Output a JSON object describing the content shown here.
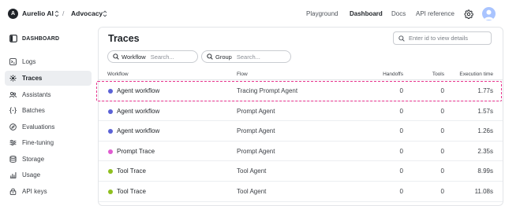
{
  "topbar": {
    "org_initial": "A",
    "org_name": "Aurelio AI",
    "separator": "/",
    "project_name": "Advocacy",
    "nav": [
      {
        "label": "Playground",
        "active": false
      },
      {
        "label": "Dashboard",
        "active": true
      },
      {
        "label": "Docs",
        "active": false
      },
      {
        "label": "API reference",
        "active": false
      }
    ],
    "settings_icon": "gear-icon",
    "avatar_icon": "user-avatar-icon"
  },
  "sidebar": {
    "title": "DASHBOARD",
    "title_icon": "sidebar-panel-icon",
    "items": [
      {
        "label": "Logs",
        "icon": "logs-icon",
        "active": false
      },
      {
        "label": "Traces",
        "icon": "traces-icon",
        "active": true
      },
      {
        "label": "Assistants",
        "icon": "assistants-icon",
        "active": false
      },
      {
        "label": "Batches",
        "icon": "batches-icon",
        "active": false
      },
      {
        "label": "Evaluations",
        "icon": "evaluations-icon",
        "active": false
      },
      {
        "label": "Fine-tuning",
        "icon": "fine-tuning-icon",
        "active": false
      },
      {
        "label": "Storage",
        "icon": "storage-icon",
        "active": false
      },
      {
        "label": "Usage",
        "icon": "usage-icon",
        "active": false
      },
      {
        "label": "API keys",
        "icon": "api-keys-icon",
        "active": false
      }
    ]
  },
  "main": {
    "title": "Traces",
    "id_search": {
      "value": "",
      "placeholder": "Enter id to view details"
    },
    "filters": [
      {
        "label": "Workflow",
        "value": "",
        "placeholder": "Search..."
      },
      {
        "label": "Group",
        "value": "",
        "placeholder": "Search..."
      }
    ],
    "columns": {
      "workflow": "Workflow",
      "flow": "Flow",
      "handoffs": "Handoffs",
      "tools": "Tools",
      "execution_time": "Execution time"
    },
    "rows": [
      {
        "workflow": "Agent workflow",
        "flow": "Tracing Prompt Agent",
        "handoffs": "0",
        "tools": "0",
        "execution_time": "1.77s",
        "dot_color": "#5b62d6"
      },
      {
        "workflow": "Agent workflow",
        "flow": "Prompt Agent",
        "handoffs": "0",
        "tools": "0",
        "execution_time": "1.57s",
        "dot_color": "#5b62d6"
      },
      {
        "workflow": "Agent workflow",
        "flow": "Prompt Agent",
        "handoffs": "0",
        "tools": "0",
        "execution_time": "1.26s",
        "dot_color": "#5b62d6"
      },
      {
        "workflow": "Prompt Trace",
        "flow": "Prompt Agent",
        "handoffs": "0",
        "tools": "0",
        "execution_time": "2.35s",
        "dot_color": "#e05bd0"
      },
      {
        "workflow": "Tool Trace",
        "flow": "Tool Agent",
        "handoffs": "0",
        "tools": "0",
        "execution_time": "8.99s",
        "dot_color": "#8fbf1f"
      },
      {
        "workflow": "Tool Trace",
        "flow": "Tool Agent",
        "handoffs": "0",
        "tools": "0",
        "execution_time": "11.08s",
        "dot_color": "#8fbf1f"
      }
    ],
    "highlight_color": "#e8338d"
  }
}
